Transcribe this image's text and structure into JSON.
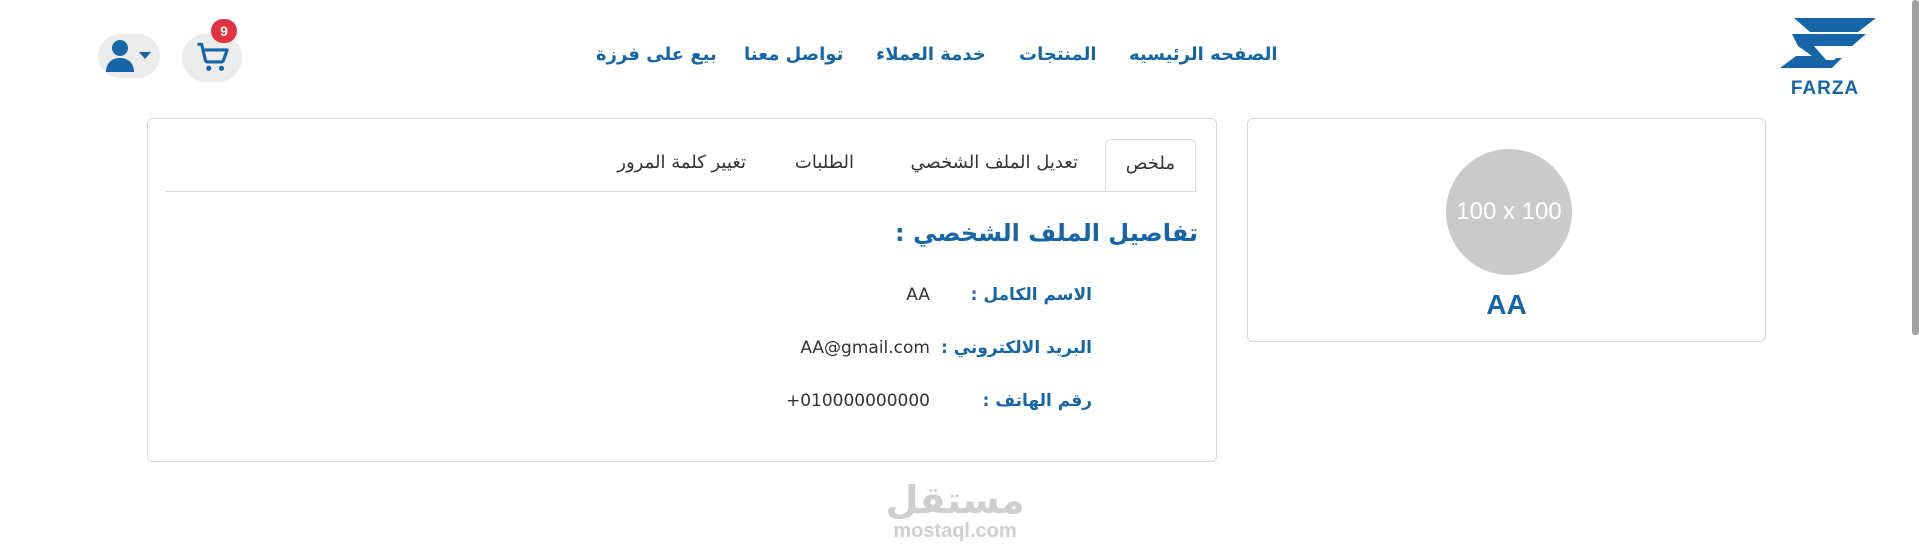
{
  "brand": {
    "name": "FARZA",
    "color": "#1565a8"
  },
  "nav": {
    "home": "الصفحه الرئيسيه",
    "products": "المنتجات",
    "customer_service": "خدمة العملاء",
    "contact": "تواصل معنا",
    "sell": "بيع على فرزة"
  },
  "cart": {
    "icon": "cart-icon",
    "count": "9",
    "badge_color": "#e23140"
  },
  "user_menu": {
    "icon": "user-icon",
    "dropdown_icon": "caret-down-icon"
  },
  "profile": {
    "avatar_placeholder": "100 x 100",
    "name": "AA"
  },
  "tabs": {
    "summary": "ملخص",
    "edit_profile": "تعديل الملف الشخصي",
    "orders": "الطلبات",
    "change_password": "تغيير كلمة المرور"
  },
  "details": {
    "title": "تفاصيل الملف الشخصي :",
    "full_name_label": "الاسم الكامل :",
    "full_name_value": "AA",
    "email_label": "البريد الالكتروني :",
    "email_value": "AA@gmail.com",
    "phone_label": "رقم الهاتف :",
    "phone_value": "+010000000000"
  },
  "watermark": {
    "arabic": "مستقل",
    "latin": "mostaql.com"
  }
}
